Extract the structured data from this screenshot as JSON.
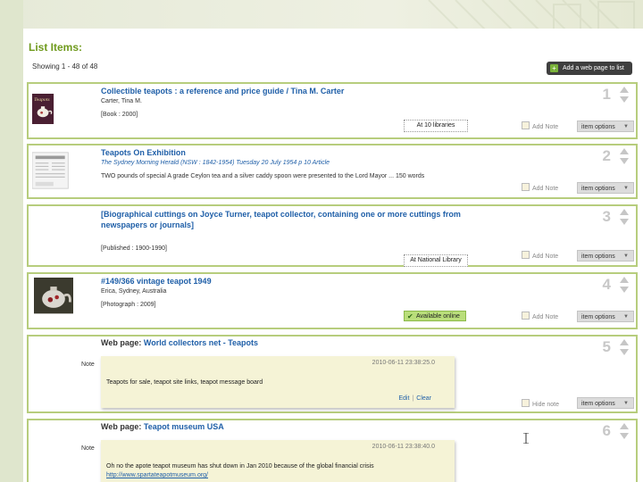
{
  "header": {
    "title": "List Items:",
    "showing": "Showing 1 - 48 of 48",
    "add_web_page": "Add a web page to list"
  },
  "common": {
    "add_note": "Add Note",
    "hide_note": "Hide note",
    "item_options": "item options",
    "note_label": "Note",
    "edit": "Edit",
    "clear": "Clear"
  },
  "rows": [
    {
      "rank": "1",
      "title": "Collectible teapots : a reference and price guide / Tina M. Carter",
      "subtitle": "Carter, Tina M.",
      "meta": "[Book : 2000]",
      "badge": "At 10 libraries"
    },
    {
      "rank": "2",
      "title": "Teapots On Exhibition",
      "subtitle": "The Sydney Morning Herald (NSW : 1842-1954) Tuesday 20 July 1954 p 10 Article",
      "meta": "TWO pounds of special A grade Ceylon tea and a silver caddy spoon were presented to the Lord Mayor ... 150 words"
    },
    {
      "rank": "3",
      "title": "[Biographical cuttings on Joyce Turner, teapot collector, containing one or more cuttings from newspapers or journals]",
      "meta": "[Published : 1900-1990]",
      "badge": "At National Library"
    },
    {
      "rank": "4",
      "title": "#149/366 vintage teapot 1949",
      "subtitle": "Erica, Sydney, Australia",
      "meta": "[Photograph : 2009]",
      "badge": "Available online"
    },
    {
      "rank": "5",
      "web_prefix": "Web page:",
      "title": "World collectors net - Teapots",
      "note_date": "2010-06-11 23:38:25.0",
      "note_text": "Teapots for sale, teapot site links, teapot message board"
    },
    {
      "rank": "6",
      "web_prefix": "Web page:",
      "title": "Teapot museum USA",
      "note_date": "2010-06-11 23:38:40.0",
      "note_text": "Oh no the apote teapot museum has shut down in Jan 2010 because of the global financial crisis",
      "note_link": "http://www.spartateapotmuseum.org/"
    }
  ],
  "colors": {
    "accent": "#6f9a1d",
    "link": "#1f5fa8",
    "row_border": "#b7cd7d",
    "note_bg": "#f5f3d6",
    "online_badge": "#b9de7a"
  }
}
